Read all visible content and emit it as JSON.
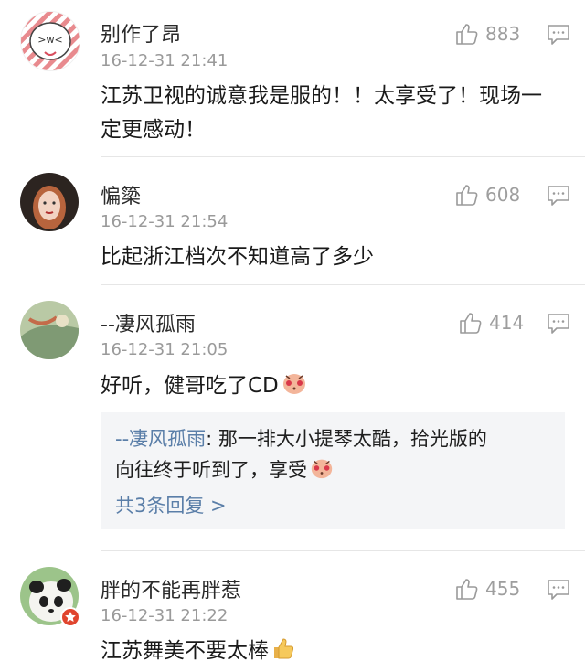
{
  "comments": [
    {
      "username": "别作了昂",
      "timestamp": "16-12-31 21:41",
      "likes": "883",
      "text": "江苏卫视的诚意我是服的！！太享受了！现场一定更感动！"
    },
    {
      "username": "惼簗",
      "timestamp": "16-12-31 21:54",
      "likes": "608",
      "text": "比起浙江档次不知道高了多少"
    },
    {
      "username": "--凄风孤雨",
      "timestamp": "16-12-31 21:05",
      "likes": "414",
      "text": "好听，健哥吃了CD",
      "reply": {
        "author": "--凄风孤雨",
        "separator": ": ",
        "text_line1": "那一排大小提琴太酷，拾光版的",
        "text_line2": "向往终于听到了，享受",
        "more_label": "共3条回复 >"
      }
    },
    {
      "username": "胖的不能再胖惹",
      "timestamp": "16-12-31 21:22",
      "likes": "455",
      "text": "江苏舞美不要太棒"
    }
  ],
  "icons": {
    "like": "thumbs-up-icon",
    "reply": "comment-icon",
    "emoji_shy": "shy-face-emoji",
    "emoji_thumb": "thumbs-up-emoji"
  },
  "colors": {
    "link": "#5a7ea8",
    "meta": "#9a9a9a",
    "reply_bg": "#f4f5f7"
  }
}
